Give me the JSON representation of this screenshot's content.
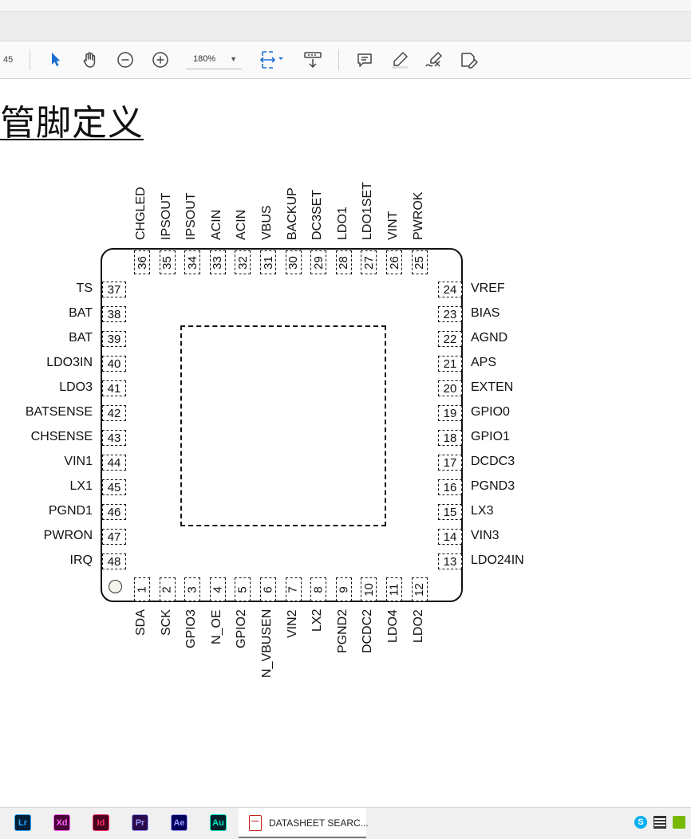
{
  "toolbar": {
    "page_number": "45",
    "zoom_value": "180%",
    "icons": [
      "select-arrow-icon",
      "hand-tool-icon",
      "zoom-out-icon",
      "zoom-in-icon",
      "fit-page-icon",
      "scroll-mode-icon",
      "comment-icon",
      "highlight-icon",
      "draw-icon",
      "fill-sign-icon"
    ]
  },
  "document": {
    "heading": "管脚定义",
    "pins_top": [
      {
        "num": "36",
        "name": "CHGLED"
      },
      {
        "num": "35",
        "name": "IPSOUT"
      },
      {
        "num": "34",
        "name": "IPSOUT"
      },
      {
        "num": "33",
        "name": "ACIN"
      },
      {
        "num": "32",
        "name": "ACIN"
      },
      {
        "num": "31",
        "name": "VBUS"
      },
      {
        "num": "30",
        "name": "BACKUP"
      },
      {
        "num": "29",
        "name": "DC3SET"
      },
      {
        "num": "28",
        "name": "LDO1"
      },
      {
        "num": "27",
        "name": "LDO1SET"
      },
      {
        "num": "26",
        "name": "VINT"
      },
      {
        "num": "25",
        "name": "PWROK"
      }
    ],
    "pins_left": [
      {
        "num": "37",
        "name": "TS"
      },
      {
        "num": "38",
        "name": "BAT"
      },
      {
        "num": "39",
        "name": "BAT"
      },
      {
        "num": "40",
        "name": "LDO3IN"
      },
      {
        "num": "41",
        "name": "LDO3"
      },
      {
        "num": "42",
        "name": "BATSENSE"
      },
      {
        "num": "43",
        "name": "CHSENSE"
      },
      {
        "num": "44",
        "name": "VIN1"
      },
      {
        "num": "45",
        "name": "LX1"
      },
      {
        "num": "46",
        "name": "PGND1"
      },
      {
        "num": "47",
        "name": "PWRON"
      },
      {
        "num": "48",
        "name": "IRQ"
      }
    ],
    "pins_right": [
      {
        "num": "24",
        "name": "VREF"
      },
      {
        "num": "23",
        "name": "BIAS"
      },
      {
        "num": "22",
        "name": "AGND"
      },
      {
        "num": "21",
        "name": "APS"
      },
      {
        "num": "20",
        "name": "EXTEN"
      },
      {
        "num": "19",
        "name": "GPIO0"
      },
      {
        "num": "18",
        "name": "GPIO1"
      },
      {
        "num": "17",
        "name": "DCDC3"
      },
      {
        "num": "16",
        "name": "PGND3"
      },
      {
        "num": "15",
        "name": "LX3"
      },
      {
        "num": "14",
        "name": "VIN3"
      },
      {
        "num": "13",
        "name": "LDO24IN"
      }
    ],
    "pins_bottom": [
      {
        "num": "1",
        "name": "SDA"
      },
      {
        "num": "2",
        "name": "SCK"
      },
      {
        "num": "3",
        "name": "GPIO3"
      },
      {
        "num": "4",
        "name": "N_OE"
      },
      {
        "num": "5",
        "name": "GPIO2"
      },
      {
        "num": "6",
        "name": "N_VBUSEN"
      },
      {
        "num": "7",
        "name": "VIN2"
      },
      {
        "num": "8",
        "name": "LX2"
      },
      {
        "num": "9",
        "name": "PGND2"
      },
      {
        "num": "10",
        "name": "DCDC2"
      },
      {
        "num": "11",
        "name": "LDO4"
      },
      {
        "num": "12",
        "name": "LDO2"
      }
    ]
  },
  "taskbar": {
    "apps": [
      {
        "name": "lightroom",
        "label": "Lr",
        "color": "#31a8ff",
        "bg": "#001e36"
      },
      {
        "name": "xd",
        "label": "Xd",
        "color": "#ff61f6",
        "bg": "#470137"
      },
      {
        "name": "indesign",
        "label": "Id",
        "color": "#ff3366",
        "bg": "#49021f"
      },
      {
        "name": "premiere",
        "label": "Pr",
        "color": "#9999ff",
        "bg": "#2a0a4a"
      },
      {
        "name": "after-effects",
        "label": "Ae",
        "color": "#9999ff",
        "bg": "#00005b"
      },
      {
        "name": "audition",
        "label": "Au",
        "color": "#00e4bb",
        "bg": "#00202b"
      }
    ],
    "active_window": "DATASHEET SEARC..."
  }
}
